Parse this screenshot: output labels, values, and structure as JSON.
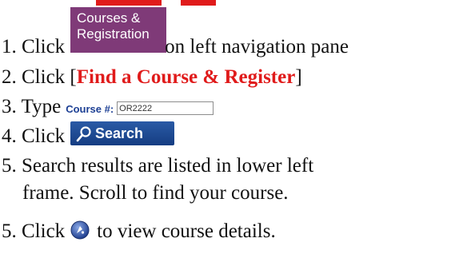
{
  "steps": [
    {
      "number": "1.",
      "prefix": "Click",
      "suffix": "on left navigation pane"
    },
    {
      "number": "2.",
      "prefix": "Click [",
      "link": "Find a Course & Register",
      "suffix": "]"
    },
    {
      "number": "3.",
      "prefix": "Type"
    },
    {
      "number": "4.",
      "prefix": "Click"
    },
    {
      "number": "5.",
      "line1": "Search results are listed in lower left",
      "line2": "frame. Scroll to find your course."
    },
    {
      "number": "5.",
      "prefix": "Click",
      "suffix": "to view course details."
    }
  ],
  "courses_button": {
    "line1": "Courses &",
    "line2": "Registration"
  },
  "course_field": {
    "label": "Course #:",
    "value": "OR2222"
  },
  "search_button": {
    "label": "Search",
    "icon": "magnifier-icon"
  },
  "info_icon": "info-circle-icon",
  "colors": {
    "accent_red": "#e01b1b",
    "purple_button": "#7f3a78",
    "blue_button": "#1c4a93",
    "label_blue": "#1c3f94"
  }
}
